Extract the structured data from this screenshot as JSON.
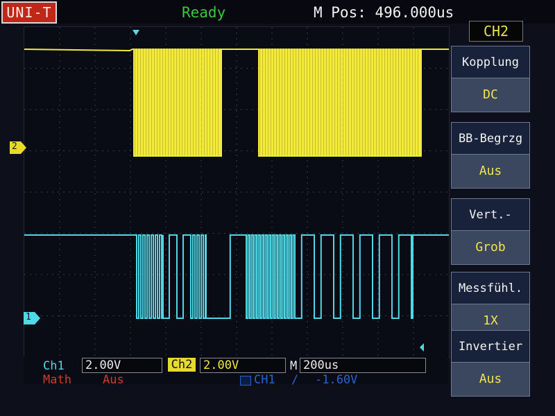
{
  "header": {
    "brand": "UNI-T",
    "status": "Ready",
    "mpos_label": "M Pos: 496.000us",
    "channel": "CH2"
  },
  "menu": [
    {
      "label": "Kopplung",
      "value": "DC"
    },
    {
      "label": "BB-Begrzg",
      "value": "Aus"
    },
    {
      "label": "Vert.-Aufl.",
      "value": "Grob"
    },
    {
      "label": "Messfühl.",
      "value": "1X"
    },
    {
      "label": "Invertier",
      "value": "Aus"
    }
  ],
  "bottom": {
    "ch1_label": "Ch1",
    "ch1_scale": "2.00V",
    "ch2_label": "Ch2",
    "ch2_scale": "2.00V",
    "time_label": "M",
    "time_scale": "200us",
    "math_label": "Math",
    "math_value": "Aus",
    "trigger_source": "CH1",
    "trigger_slope": "/",
    "trigger_level": "-1.60V"
  },
  "markers": {
    "ch2": "2",
    "ch1": "1"
  },
  "colors": {
    "ch1": "#4fd9e6",
    "ch2": "#f3ea3a",
    "status": "#38c83a",
    "brand_bg": "#c02718",
    "math": "#d43a2a",
    "menu_value": "#f1e44f"
  }
}
